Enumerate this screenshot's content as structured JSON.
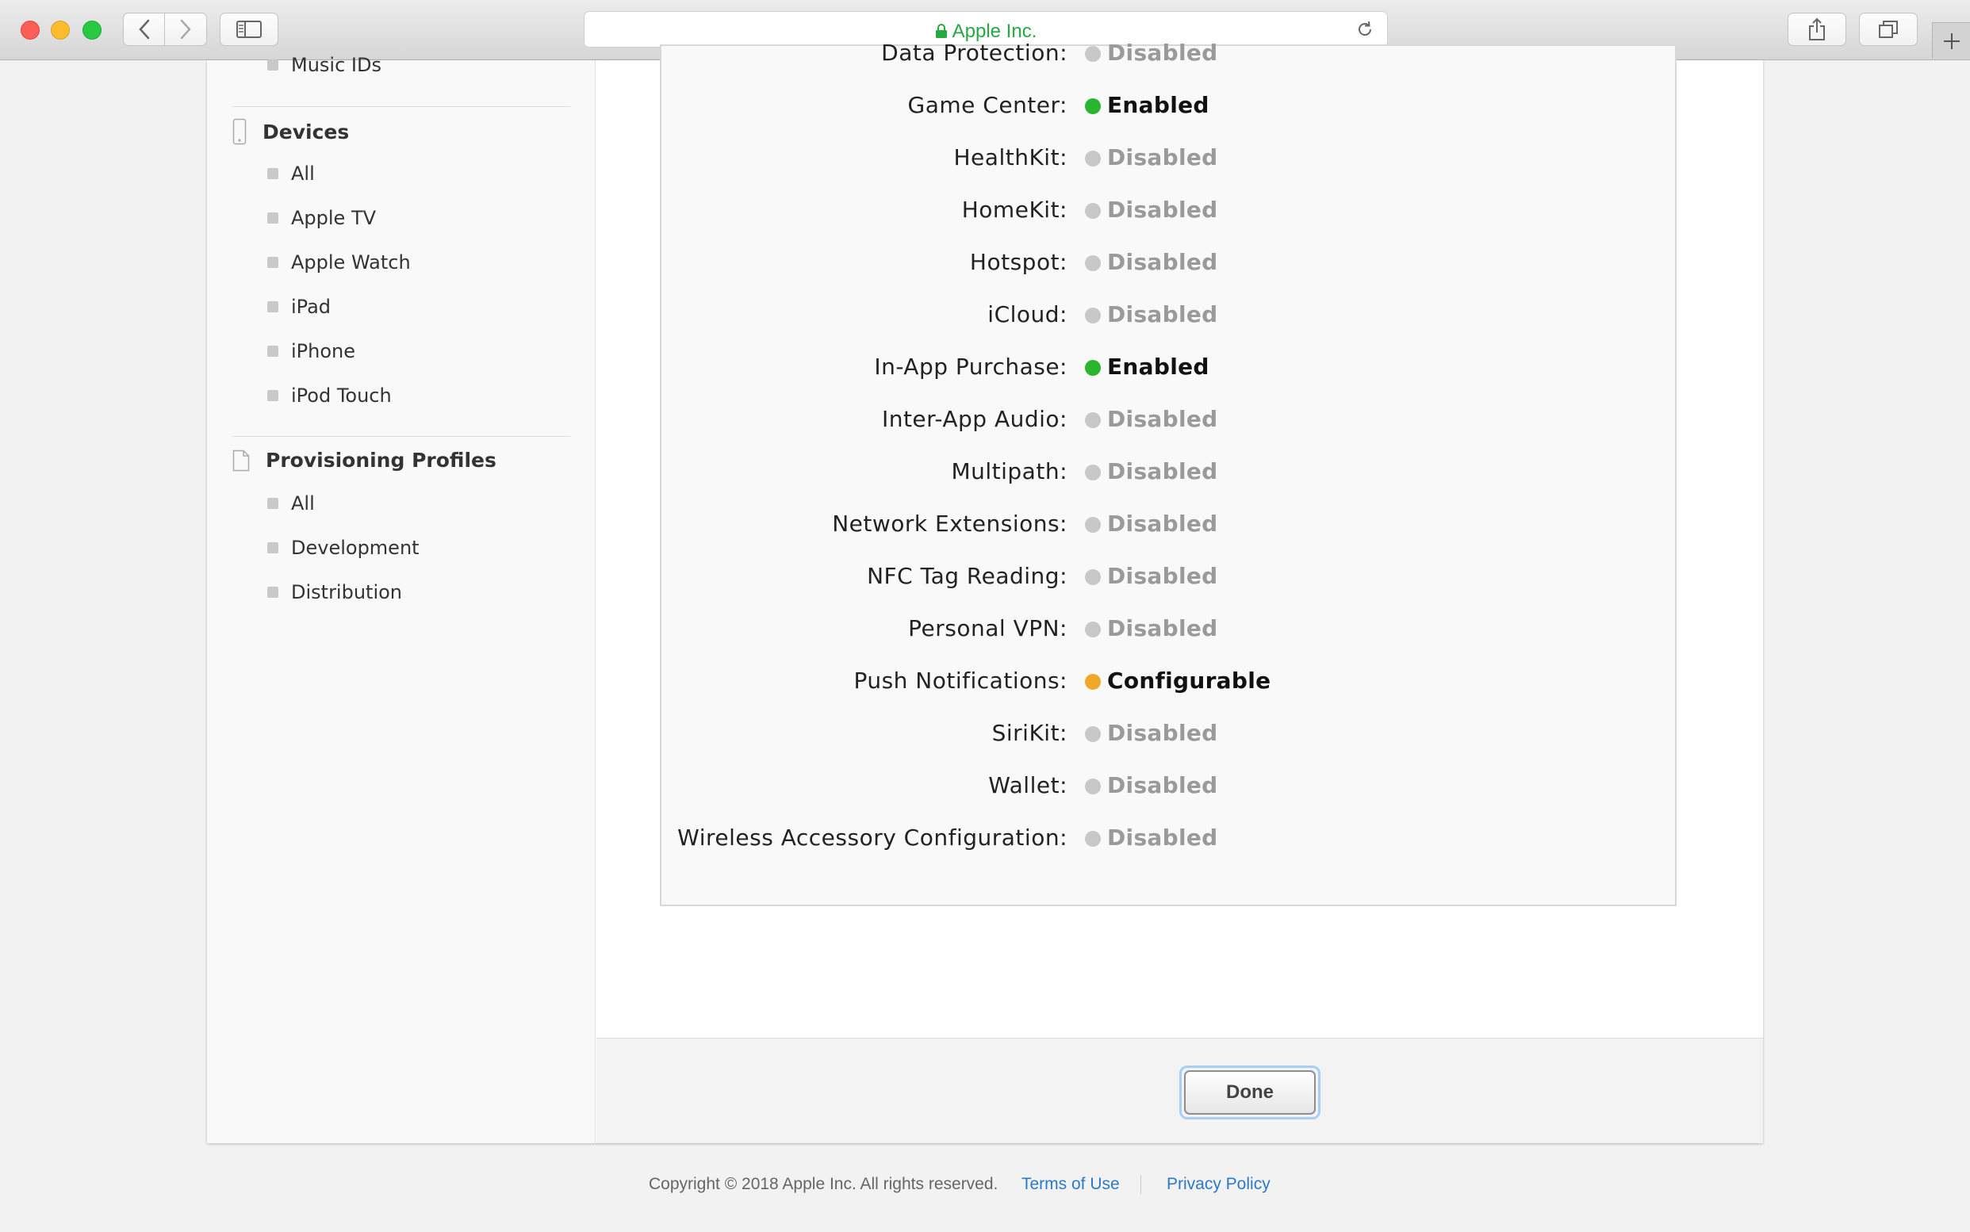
{
  "browser": {
    "address": "Apple Inc.",
    "colors": {
      "secure_text": "#27a843"
    }
  },
  "sidebar": {
    "top_items": [
      {
        "label": "Music IDs"
      }
    ],
    "sections": [
      {
        "title": "Devices",
        "icon": "phone-icon",
        "items": [
          {
            "label": "All"
          },
          {
            "label": "Apple TV"
          },
          {
            "label": "Apple Watch"
          },
          {
            "label": "iPad"
          },
          {
            "label": "iPhone"
          },
          {
            "label": "iPod Touch"
          }
        ]
      },
      {
        "title": "Provisioning Profiles",
        "icon": "document-icon",
        "items": [
          {
            "label": "All"
          },
          {
            "label": "Development"
          },
          {
            "label": "Distribution"
          }
        ]
      }
    ]
  },
  "capabilities": [
    {
      "label": "Data Protection:",
      "status": "Disabled",
      "state": "disabled"
    },
    {
      "label": "Game Center:",
      "status": "Enabled",
      "state": "enabled"
    },
    {
      "label": "HealthKit:",
      "status": "Disabled",
      "state": "disabled"
    },
    {
      "label": "HomeKit:",
      "status": "Disabled",
      "state": "disabled"
    },
    {
      "label": "Hotspot:",
      "status": "Disabled",
      "state": "disabled"
    },
    {
      "label": "iCloud:",
      "status": "Disabled",
      "state": "disabled"
    },
    {
      "label": "In-App Purchase:",
      "status": "Enabled",
      "state": "enabled"
    },
    {
      "label": "Inter-App Audio:",
      "status": "Disabled",
      "state": "disabled"
    },
    {
      "label": "Multipath:",
      "status": "Disabled",
      "state": "disabled"
    },
    {
      "label": "Network Extensions:",
      "status": "Disabled",
      "state": "disabled"
    },
    {
      "label": "NFC Tag Reading:",
      "status": "Disabled",
      "state": "disabled"
    },
    {
      "label": "Personal VPN:",
      "status": "Disabled",
      "state": "disabled"
    },
    {
      "label": "Push Notifications:",
      "status": "Configurable",
      "state": "configurable"
    },
    {
      "label": "SiriKit:",
      "status": "Disabled",
      "state": "disabled"
    },
    {
      "label": "Wallet:",
      "status": "Disabled",
      "state": "disabled"
    },
    {
      "label": "Wireless Accessory Configuration:",
      "status": "Disabled",
      "state": "disabled"
    }
  ],
  "state_colors": {
    "enabled": {
      "dot": "#29b52f",
      "text": "#111111"
    },
    "disabled": {
      "dot": "#c8c8c8",
      "text": "#9a9a9a"
    },
    "configurable": {
      "dot": "#f0a82a",
      "text": "#111111"
    }
  },
  "actions": {
    "done_label": "Done"
  },
  "footer": {
    "copyright": "Copyright © 2018 Apple Inc. All rights reserved.",
    "terms": "Terms of Use",
    "privacy": "Privacy Policy"
  }
}
